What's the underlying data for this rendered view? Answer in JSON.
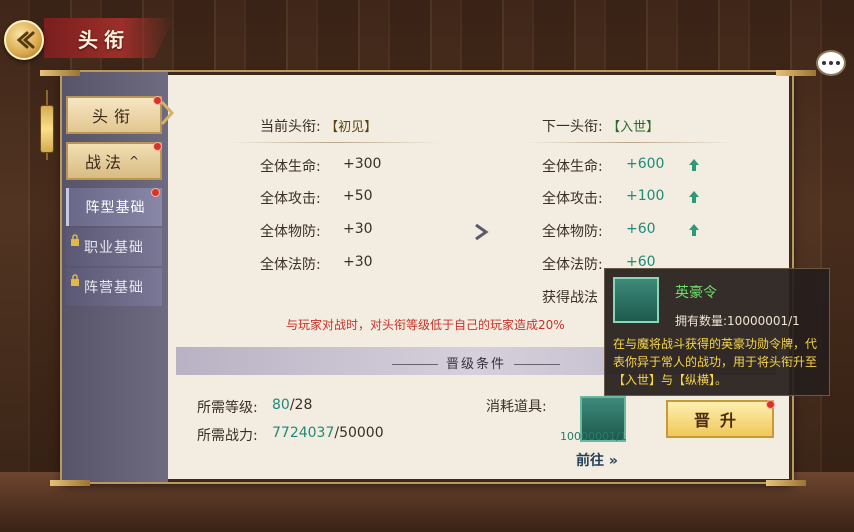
{
  "header": {
    "title": "头衔"
  },
  "sidebar": {
    "items": [
      {
        "label": "头衔"
      },
      {
        "label": "战法",
        "caret": "^"
      },
      {
        "label": "阵型基础"
      },
      {
        "label": "职业基础"
      },
      {
        "label": "阵营基础"
      }
    ]
  },
  "current": {
    "label": "当前头衔:",
    "rank": "【初见】",
    "stats": [
      {
        "name": "全体生命:",
        "value": "+300"
      },
      {
        "name": "全体攻击:",
        "value": "+50"
      },
      {
        "name": "全体物防:",
        "value": "+30"
      },
      {
        "name": "全体法防:",
        "value": "+30"
      }
    ]
  },
  "next": {
    "label": "下一头衔:",
    "rank": "【入世】",
    "stats": [
      {
        "name": "全体生命:",
        "value": "+600"
      },
      {
        "name": "全体攻击:",
        "value": "+100"
      },
      {
        "name": "全体物防:",
        "value": "+60"
      },
      {
        "name": "全体法防:",
        "value": "+60"
      }
    ],
    "extra_label": "获得战法"
  },
  "warning": "与玩家对战时，对头衔等级低于自己的玩家造成20%",
  "conditions": {
    "title": "晋级条件",
    "level_label": "所需等级:",
    "level_current": "80",
    "level_required": "/28",
    "power_label": "所需战力:",
    "power_current": "7724037",
    "power_required": "/50000",
    "consume_label": "消耗道具:",
    "item_count": "10000001/1",
    "goto_label": "前往",
    "upgrade_label": "晋升"
  },
  "tooltip": {
    "item_name": "英豪令",
    "own_label": "拥有数量:",
    "own_value": "10000001/1",
    "description": "在与魔将战斗获得的英豪功勋令牌，代表你异于常人的战功，用于将头衔升至【入世】与【纵横】。"
  },
  "colors": {
    "accent_green": "#1f8a7a",
    "warning_red": "#c8322a",
    "tooltip_name": "#6ae06a"
  }
}
